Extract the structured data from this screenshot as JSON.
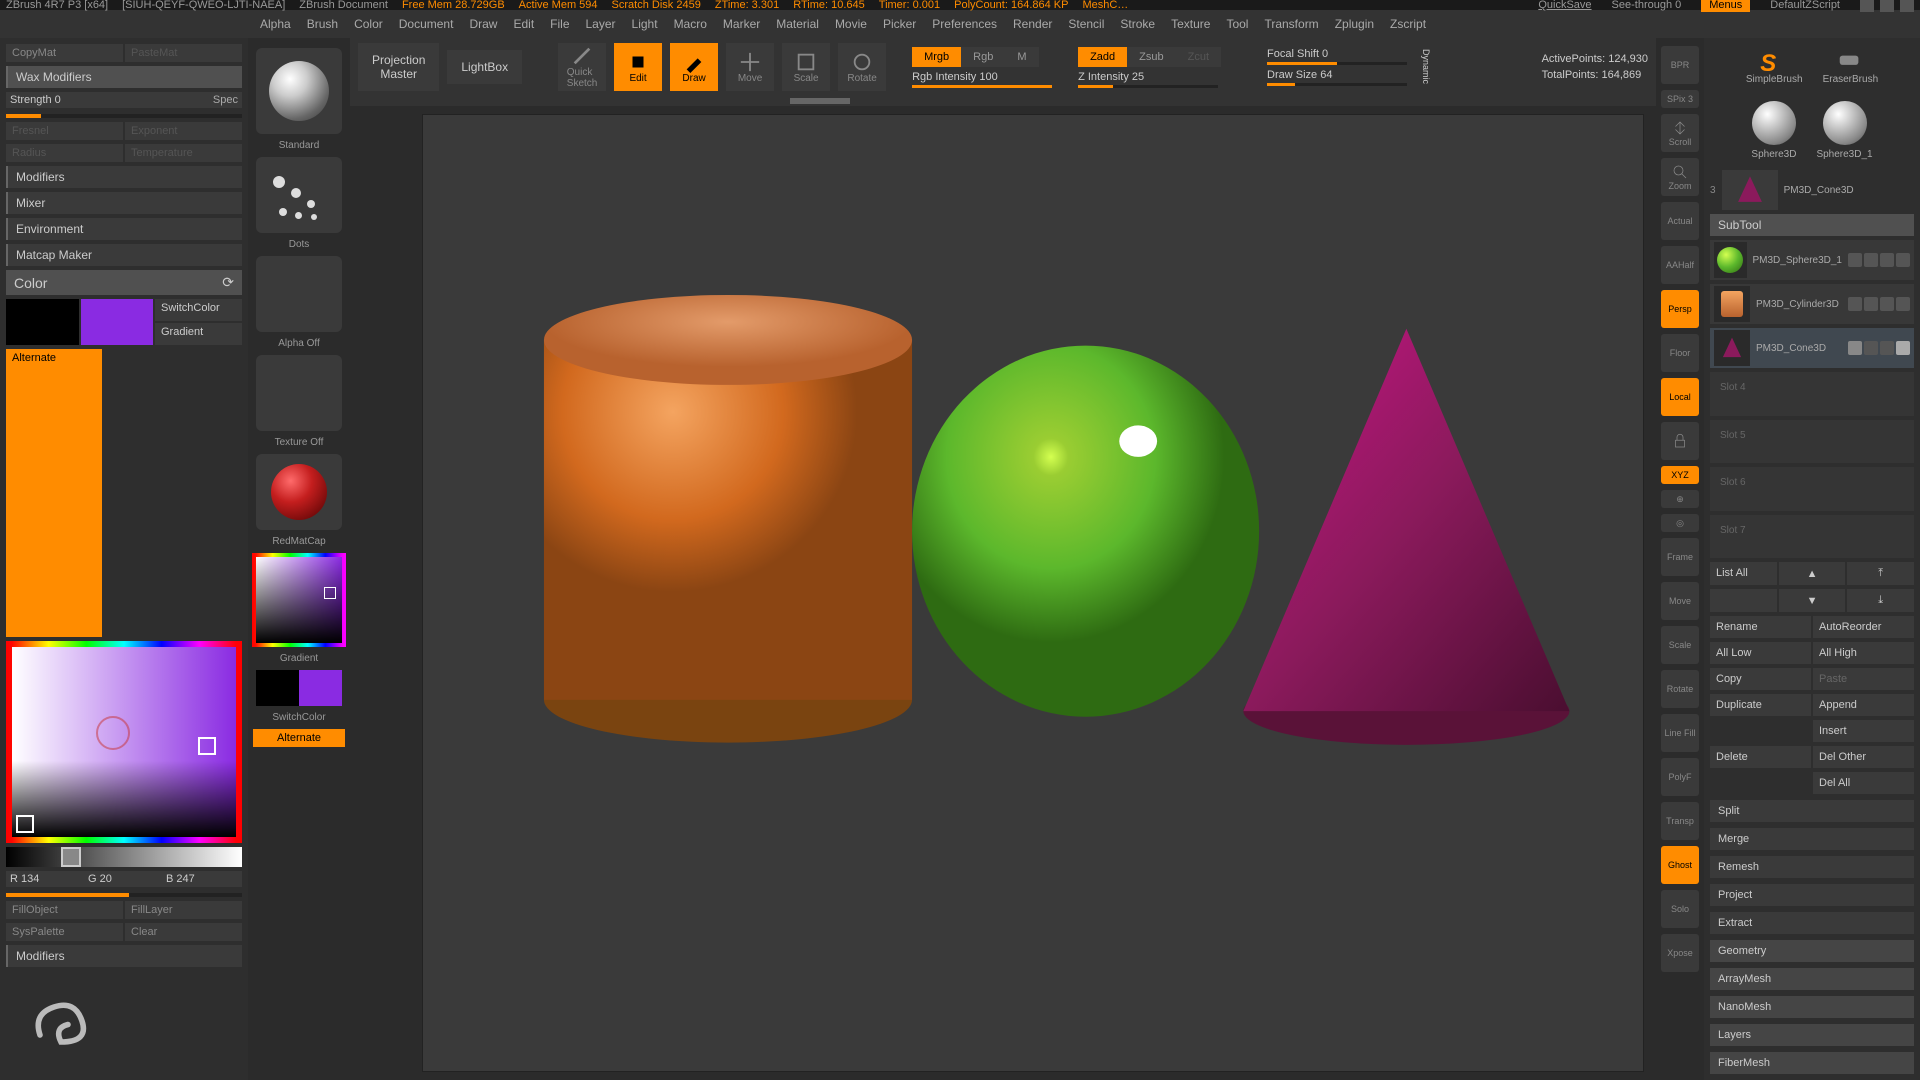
{
  "title": {
    "app": "ZBrush 4R7 P3 [x64]",
    "doc": "[SIUH-QEYF-QWEO-LJTI-NAEA]",
    "docname": "ZBrush Document",
    "mem": "Free Mem 28.729GB",
    "amem": "Active Mem 594",
    "scratch": "Scratch Disk 2459",
    "ztime": "ZTime: 3.301",
    "rtime": "RTime: 10.645",
    "timer": "Timer: 0.001",
    "poly": "PolyCount: 164.864 KP",
    "mesh": "MeshC…",
    "quicksave": "QuickSave",
    "seethrough": "See-through   0",
    "menus": "Menus",
    "script": "DefaultZScript"
  },
  "menu": [
    "Alpha",
    "Brush",
    "Color",
    "Document",
    "Draw",
    "Edit",
    "File",
    "Layer",
    "Light",
    "Macro",
    "Marker",
    "Material",
    "Movie",
    "Picker",
    "Preferences",
    "Render",
    "Stencil",
    "Stroke",
    "Texture",
    "Tool",
    "Transform",
    "Zplugin",
    "Zscript"
  ],
  "left": {
    "copymat": "CopyMat",
    "pastemat": "PasteMat",
    "wax": "Wax Modifiers",
    "strength": "Strength 0",
    "spec": "Spec",
    "fresnel": "Fresnel",
    "exponent": "Exponent",
    "radius": "Radius",
    "temperature": "Temperature",
    "modifiers": "Modifiers",
    "mixer": "Mixer",
    "env": "Environment",
    "matcap": "Matcap Maker",
    "color": "Color",
    "switchcolor": "SwitchColor",
    "gradient": "Gradient",
    "alternate": "Alternate",
    "r": "R 134",
    "g": "G 20",
    "b": "B 247",
    "fillobj": "FillObject",
    "filllayer": "FillLayer",
    "syspal": "SysPalette",
    "clear": "Clear",
    "modifiers2": "Modifiers"
  },
  "toolcol": {
    "standard": "Standard",
    "dots": "Dots",
    "alphaoff": "Alpha  Off",
    "texoff": "Texture  Off",
    "redmat": "RedMatCap",
    "gradient": "Gradient",
    "switchcolor": "SwitchColor",
    "alternate": "Alternate"
  },
  "toolbar": {
    "proj": "Projection\nMaster",
    "lightbox": "LightBox",
    "quick": "Quick\nSketch",
    "edit": "Edit",
    "draw": "Draw",
    "move": "Move",
    "scale": "Scale",
    "rotate": "Rotate",
    "mrgb": "Mrgb",
    "rgb": "Rgb",
    "m": "M",
    "rgbint": "Rgb Intensity 100",
    "zadd": "Zadd",
    "zsub": "Zsub",
    "zcut": "Zcut",
    "zint": "Z Intensity 25",
    "focal": "Focal Shift 0",
    "drawsize": "Draw Size 64",
    "dynamic": "Dynamic",
    "active": "ActivePoints:  124,930",
    "total": "TotalPoints:  164,869"
  },
  "rtools": [
    "BPR",
    "SPix 3",
    "Scroll",
    "Zoom",
    "Actual",
    "AAHalf",
    "Persp",
    "Floor",
    "Local",
    "XYZ",
    "",
    "",
    "Frame",
    "Move",
    "Scale",
    "Rotate",
    "Line Fill",
    "PolyF",
    "Transp",
    "Ghost",
    "Solo",
    "Xpose"
  ],
  "right": {
    "simple": "SimpleBrush",
    "simplelogo": "S",
    "eraser": "EraserBrush",
    "sphere3d": "Sphere3D",
    "sphere3d1": "Sphere3D_1",
    "cone": "PM3D_Cone3D",
    "subtool": "SubTool",
    "st": [
      {
        "name": "PM3D_Sphere3D_1"
      },
      {
        "name": "PM3D_Cylinder3D"
      },
      {
        "name": "PM3D_Cone3D"
      }
    ],
    "slots": [
      "Slot 4",
      "Slot 5",
      "Slot 6",
      "Slot 7"
    ],
    "listall": "List All",
    "rename": "Rename",
    "autoreorder": "AutoReorder",
    "alllow": "All Low",
    "allhigh": "All High",
    "copy": "Copy",
    "paste": "Paste",
    "duplicate": "Duplicate",
    "append": "Append",
    "insert": "Insert",
    "delete": "Delete",
    "delother": "Del Other",
    "delall": "Del All",
    "split": "Split",
    "merge": "Merge",
    "remesh": "Remesh",
    "project": "Project",
    "extract": "Extract",
    "geometry": "Geometry",
    "arraymesh": "ArrayMesh",
    "nanomesh": "NanoMesh",
    "layers": "Layers",
    "fibermesh": "FiberMesh"
  }
}
